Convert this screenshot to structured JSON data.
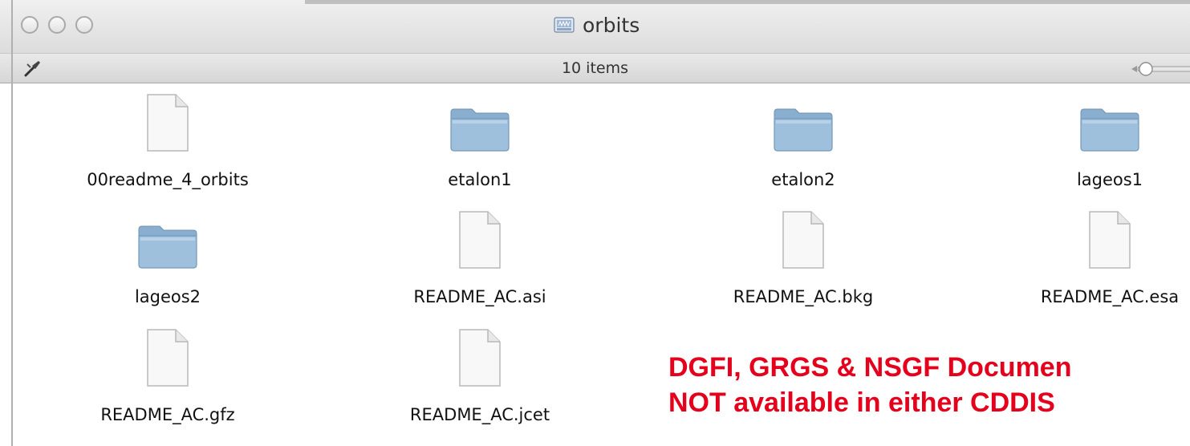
{
  "window": {
    "title": "orbits",
    "status": "10 items"
  },
  "items": [
    {
      "name": "00readme_4_orbits",
      "kind": "document"
    },
    {
      "name": "etalon1",
      "kind": "folder"
    },
    {
      "name": "etalon2",
      "kind": "folder"
    },
    {
      "name": "lageos1",
      "kind": "folder"
    },
    {
      "name": "lageos2",
      "kind": "folder"
    },
    {
      "name": "README_AC.asi",
      "kind": "document"
    },
    {
      "name": "README_AC.bkg",
      "kind": "document"
    },
    {
      "name": "README_AC.esa",
      "kind": "document"
    },
    {
      "name": "README_AC.gfz",
      "kind": "document"
    },
    {
      "name": "README_AC.jcet",
      "kind": "document"
    }
  ],
  "annotation": {
    "line1": "DGFI, GRGS & NSGF Documen",
    "line2": "NOT available in either CDDIS",
    "color": "#e5001b"
  }
}
